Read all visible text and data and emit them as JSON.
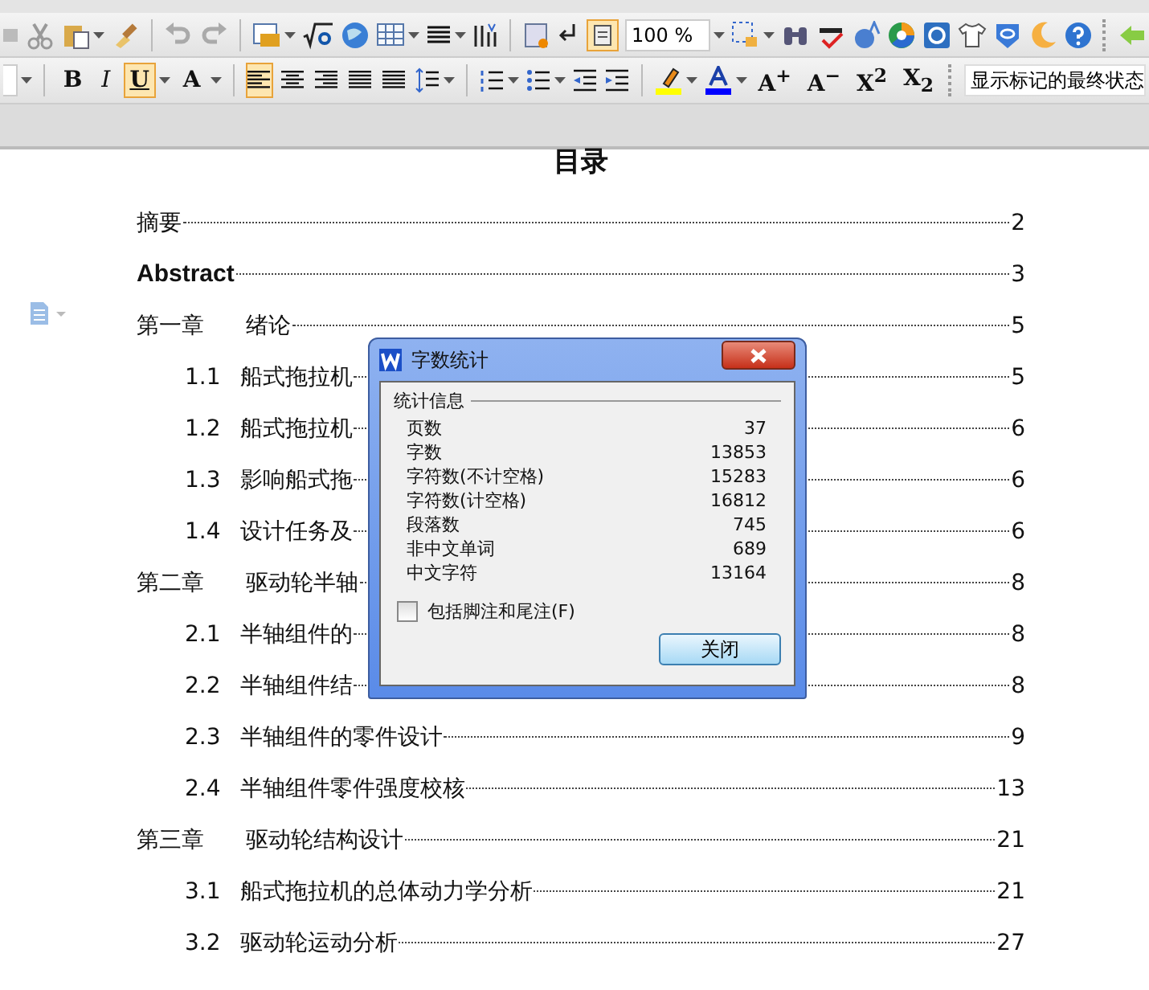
{
  "toolbar_standard": {
    "zoom": "100 %"
  },
  "toolbar_format": {
    "style_buttons": [
      {
        "label": "B",
        "selected": false
      },
      {
        "label": "I",
        "selected": false
      },
      {
        "label": "U",
        "selected": true
      }
    ],
    "grow_font": "A",
    "alignment": [
      {
        "selected": true
      },
      {
        "selected": false
      },
      {
        "selected": false
      },
      {
        "selected": false
      },
      {
        "selected": false
      }
    ],
    "size_buttons": [
      "A$^{+}$",
      "A$^{−}$",
      "X$^{2}$",
      "X$_{2}$"
    ],
    "markup_view": "显示标记的最终状态"
  },
  "document": {
    "title": "目录",
    "toc": [
      {
        "number": "摘要",
        "page": "2",
        "bold": false
      },
      {
        "number": "Abstract",
        "page": "3",
        "bold": true
      },
      {
        "number": "第一章",
        "title": "绪论",
        "page": "5",
        "bold": false,
        "children": [
          {
            "number": "1.1",
            "title": "船式拖拉机",
            "page": "5"
          },
          {
            "number": "1.2",
            "title": "船式拖拉机",
            "page": "6"
          },
          {
            "number": "1.3",
            "title": "影响船式拖",
            "page": "6"
          },
          {
            "number": "1.4",
            "title": "设计任务及",
            "page": "6"
          }
        ]
      },
      {
        "number": "第二章",
        "title": "驱动轮半轴",
        "page": "8",
        "bold": false,
        "children": [
          {
            "number": "2.1",
            "title": "半轴组件的",
            "page": "8"
          },
          {
            "number": "2.2",
            "title": "半轴组件结",
            "page": "8"
          },
          {
            "number": "2.3",
            "title": "半轴组件的零件设计",
            "page": "9"
          },
          {
            "number": "2.4",
            "title": "半轴组件零件强度校核",
            "page": "13"
          }
        ]
      },
      {
        "number": "第三章",
        "title": "驱动轮结构设计",
        "page": "21",
        "bold": false,
        "children": [
          {
            "number": "3.1",
            "title": "船式拖拉机的总体动力学分析",
            "page": "21"
          },
          {
            "number": "3.2",
            "title": "驱动轮运动分析",
            "page": "27"
          }
        ]
      }
    ]
  },
  "dialog": {
    "title": "字数统计",
    "group": "统计信息",
    "stats": [
      {
        "label": "页数",
        "value": "37"
      },
      {
        "label": "字数",
        "value": "13853"
      },
      {
        "label": "字符数(不计空格)",
        "value": "15283"
      },
      {
        "label": "字符数(计空格)",
        "value": "16812"
      },
      {
        "label": "段落数",
        "value": "745"
      },
      {
        "label": "非中文单词",
        "value": "689"
      },
      {
        "label": "中文字符",
        "value": "13164"
      }
    ],
    "checkbox": {
      "label": "包括脚注和尾注(F)",
      "checked": false
    },
    "button": "关闭"
  }
}
